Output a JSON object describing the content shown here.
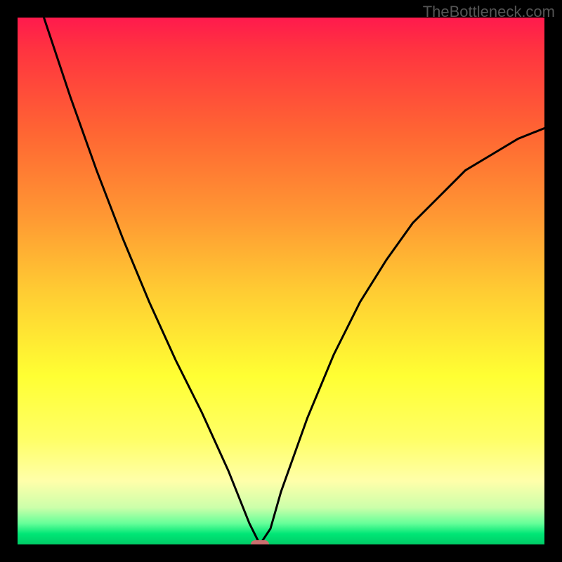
{
  "watermark": "TheBottleneck.com",
  "chart_data": {
    "type": "line",
    "title": "",
    "xlabel": "",
    "ylabel": "",
    "xlim": [
      0,
      100
    ],
    "ylim": [
      0,
      100
    ],
    "grid": false,
    "legend": false,
    "notes": "Bottleneck-style V curve on a vertical red-to-green gradient. Y ~ bottleneck %, X ~ component balance parameter. Minimum (~0%) around x≈46. Small rounded marker at the minimum.",
    "series": [
      {
        "name": "bottleneck-curve",
        "color": "#000000",
        "x": [
          0,
          5,
          10,
          15,
          20,
          25,
          30,
          35,
          40,
          44,
          46,
          48,
          50,
          55,
          60,
          65,
          70,
          75,
          80,
          85,
          90,
          95,
          100
        ],
        "values": [
          118,
          100,
          85,
          71,
          58,
          46,
          35,
          25,
          14,
          4,
          0,
          3,
          10,
          24,
          36,
          46,
          54,
          61,
          66,
          71,
          74,
          77,
          79
        ]
      }
    ],
    "min_point": {
      "x": 46,
      "y": 0
    },
    "gradient_stops": [
      {
        "pct": 0,
        "color": "#ff1a4d"
      },
      {
        "pct": 22,
        "color": "#ff6633"
      },
      {
        "pct": 52,
        "color": "#ffcc33"
      },
      {
        "pct": 80,
        "color": "#ffff66"
      },
      {
        "pct": 96,
        "color": "#66ff99"
      },
      {
        "pct": 100,
        "color": "#00cc66"
      }
    ]
  }
}
